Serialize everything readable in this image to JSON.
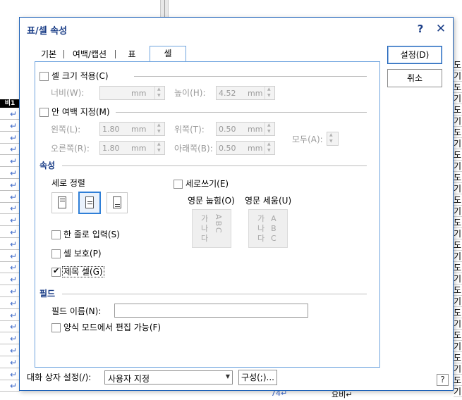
{
  "dialog": {
    "title": "표/셀 속성",
    "help": "?",
    "close": "✕"
  },
  "tabs": [
    {
      "label": "기본"
    },
    {
      "label": "여백/캡션"
    },
    {
      "label": "표"
    },
    {
      "label": "셀"
    }
  ],
  "buttons": {
    "ok": "설정(D)",
    "cancel": "취소",
    "compose": "구성(;)...",
    "help": "?"
  },
  "cell_size": {
    "title": "셀 크기 적용(C)",
    "checked": false,
    "width_label": "너비(W):",
    "width_value": "",
    "width_unit": "mm",
    "height_label": "높이(H):",
    "height_value": "4.52",
    "height_unit": "mm"
  },
  "inner_margin": {
    "title": "안 여백 지정(M)",
    "checked": false,
    "left_label": "왼쪽(L):",
    "left_value": "1.80",
    "right_label": "오른쪽(R):",
    "right_value": "1.80",
    "top_label": "위쪽(T):",
    "top_value": "0.50",
    "bottom_label": "아래쪽(B):",
    "bottom_value": "0.50",
    "all_label": "모두(A):",
    "unit": "mm"
  },
  "properties": {
    "title": "속성",
    "valign_label": "세로 정렬",
    "valign_selected": "center",
    "vertical_writing": "세로쓰기(E)",
    "vertical_writing_checked": false,
    "eng_lay": "영문 눕힘(O)",
    "eng_stand": "영문 세움(U)",
    "text_lay": [
      "가",
      "나",
      "다"
    ],
    "text_lay_eng": "ABC",
    "text_stand": [
      "가",
      "나",
      "다"
    ],
    "text_stand_eng": [
      "A",
      "B",
      "C"
    ],
    "single_line": "한 줄로 입력(S)",
    "single_line_checked": false,
    "protect": "셀 보호(P)",
    "protect_checked": false,
    "title_cell": "제목 셀(G)",
    "title_cell_checked": true
  },
  "field": {
    "title": "필드",
    "name_label": "필드 이름(N):",
    "name_value": "",
    "form_edit": "양식 모드에서 편집 가능(F)",
    "form_edit_checked": false
  },
  "dialog_setting": {
    "label": "대화 상자 설정(/):",
    "value": "사용자 지정"
  },
  "background": {
    "marker": "비1",
    "right_glyphs": [
      "도",
      "기",
      "도",
      "기",
      "도",
      "기",
      "도",
      "기",
      "도",
      "기",
      "도",
      "기",
      "도",
      "기",
      "도",
      "기",
      "도",
      "기",
      "도",
      "기",
      "도",
      "기",
      "도",
      "기",
      "도",
      "기",
      "도",
      "기",
      "도",
      "기",
      "도"
    ],
    "bottom_left": "↵",
    "bottom_mid": "74↵",
    "bottom_right": "요비↵"
  },
  "colors": {
    "accent": "#1e62b8",
    "title_text": "#1c3f88",
    "return_mark": "#3a66c8"
  }
}
